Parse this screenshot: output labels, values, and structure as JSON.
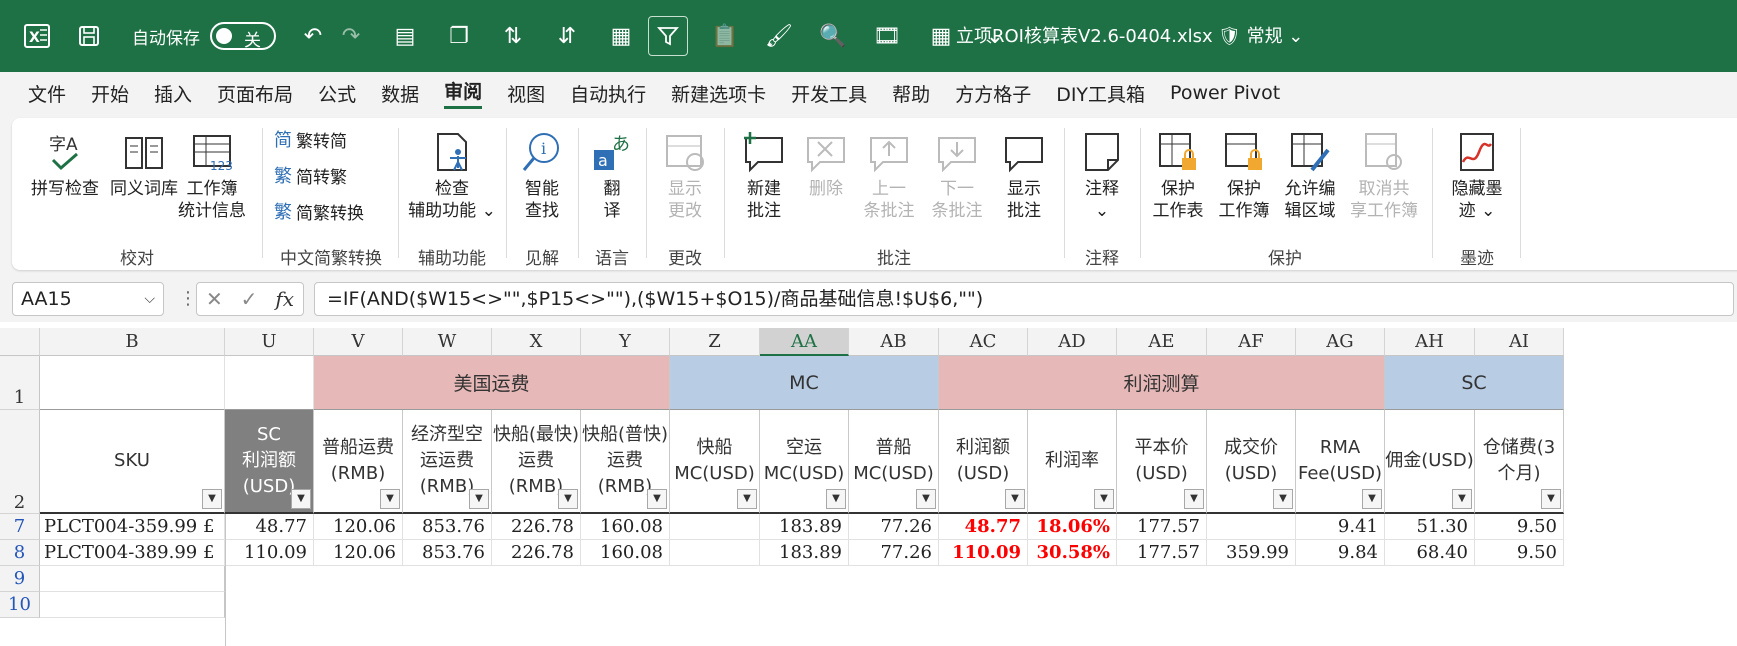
{
  "titlebar": {
    "autosave_label": "自动保存",
    "autosave_state": "关",
    "filename": "立项ROI核算表V2.6-0404.xlsx",
    "sensitivity": "常规"
  },
  "menu": [
    "文件",
    "开始",
    "插入",
    "页面布局",
    "公式",
    "数据",
    "审阅",
    "视图",
    "自动执行",
    "新建选项卡",
    "开发工具",
    "帮助",
    "方方格子",
    "DIY工具箱",
    "Power Pivot"
  ],
  "ribbon": {
    "spell_top": "字A",
    "spell": "拼写检查",
    "thesaurus": "同义词库",
    "stats_l1": "工作簿",
    "stats_l2": "统计信息",
    "g_proof": "校对",
    "to_trad": "繁转简",
    "to_simp": "简转繁",
    "conv": "简繁转换",
    "g_chinese": "中文简繁转换",
    "check_l1": "检查",
    "check_l2": "辅助功能",
    "g_access": "辅助功能",
    "smart_l1": "智能",
    "smart_l2": "查找",
    "g_insight": "见解",
    "translate_l1": "翻",
    "translate_l2": "译",
    "g_lang": "语言",
    "show_changes_l1": "显示",
    "show_changes_l2": "更改",
    "g_changes": "更改",
    "new_note_l1": "新建",
    "new_note_l2": "批注",
    "delete": "删除",
    "prev_l1": "上一",
    "prev_l2": "条批注",
    "next_l1": "下一",
    "next_l2": "条批注",
    "show_note_l1": "显示",
    "show_note_l2": "批注",
    "g_comments": "批注",
    "notes": "注释",
    "g_notes": "注释",
    "protect_sheet_l1": "保护",
    "protect_sheet_l2": "工作表",
    "protect_book_l1": "保护",
    "protect_book_l2": "工作簿",
    "allow_edit_l1": "允许编",
    "allow_edit_l2": "辑区域",
    "unshare_l1": "取消共",
    "unshare_l2": "享工作簿",
    "g_protect": "保护",
    "hide_ink_l1": "隐藏墨",
    "hide_ink_l2": "迹",
    "g_ink": "墨迹"
  },
  "formula_bar": {
    "cell_ref": "AA15",
    "formula": "=IF(AND($W15<>\"\",$P15<>\"\"),($W15+$O15)/商品基础信息!$U$6,\"\")"
  },
  "sheet": {
    "col_headers": [
      "B",
      "U",
      "V",
      "W",
      "X",
      "Y",
      "Z",
      "AA",
      "AB",
      "AC",
      "AD",
      "AE",
      "AF",
      "AG",
      "AH",
      "AI"
    ],
    "row_headers": [
      "1",
      "2",
      "7",
      "8",
      "9",
      "10"
    ],
    "bands": [
      "美国运费",
      "MC",
      "利润测算",
      "SC"
    ],
    "headers": [
      [
        "SKU"
      ],
      [
        "SC",
        "利润额",
        "(USD)"
      ],
      [
        "普船运费",
        "(RMB)"
      ],
      [
        "经济型空",
        "运运费",
        "(RMB)"
      ],
      [
        "快船(最快)",
        "运费",
        "(RMB)"
      ],
      [
        "快船(普快)",
        "运费",
        "(RMB)"
      ],
      [
        "快船",
        "MC(USD)"
      ],
      [
        "空运",
        "MC(USD)"
      ],
      [
        "普船",
        "MC(USD)"
      ],
      [
        "利润额",
        "(USD)"
      ],
      [
        "利润率"
      ],
      [
        "平本价",
        "(USD)"
      ],
      [
        "成交价",
        "(USD)"
      ],
      [
        "RMA",
        "Fee(USD)"
      ],
      [
        "佣金(USD)"
      ],
      [
        "仓储费(3",
        "个月)"
      ]
    ],
    "rows": [
      [
        "PLCT004-359.99 £",
        "48.77",
        "120.06",
        "853.76",
        "226.78",
        "160.08",
        "",
        "183.89",
        "77.26",
        "48.77",
        "18.06%",
        "177.57",
        "",
        "9.41",
        "51.30",
        "9.50"
      ],
      [
        "PLCT004-389.99 £",
        "110.09",
        "120.06",
        "853.76",
        "226.78",
        "160.08",
        "",
        "183.89",
        "77.26",
        "110.09",
        "30.58%",
        "177.57",
        "359.99",
        "9.84",
        "68.40",
        "9.50"
      ]
    ],
    "colors": {
      "band_red": "#e6b8b7",
      "band_blue": "#b8cce4",
      "header_gray": "#808080",
      "profit_red": "#ff0000"
    }
  }
}
